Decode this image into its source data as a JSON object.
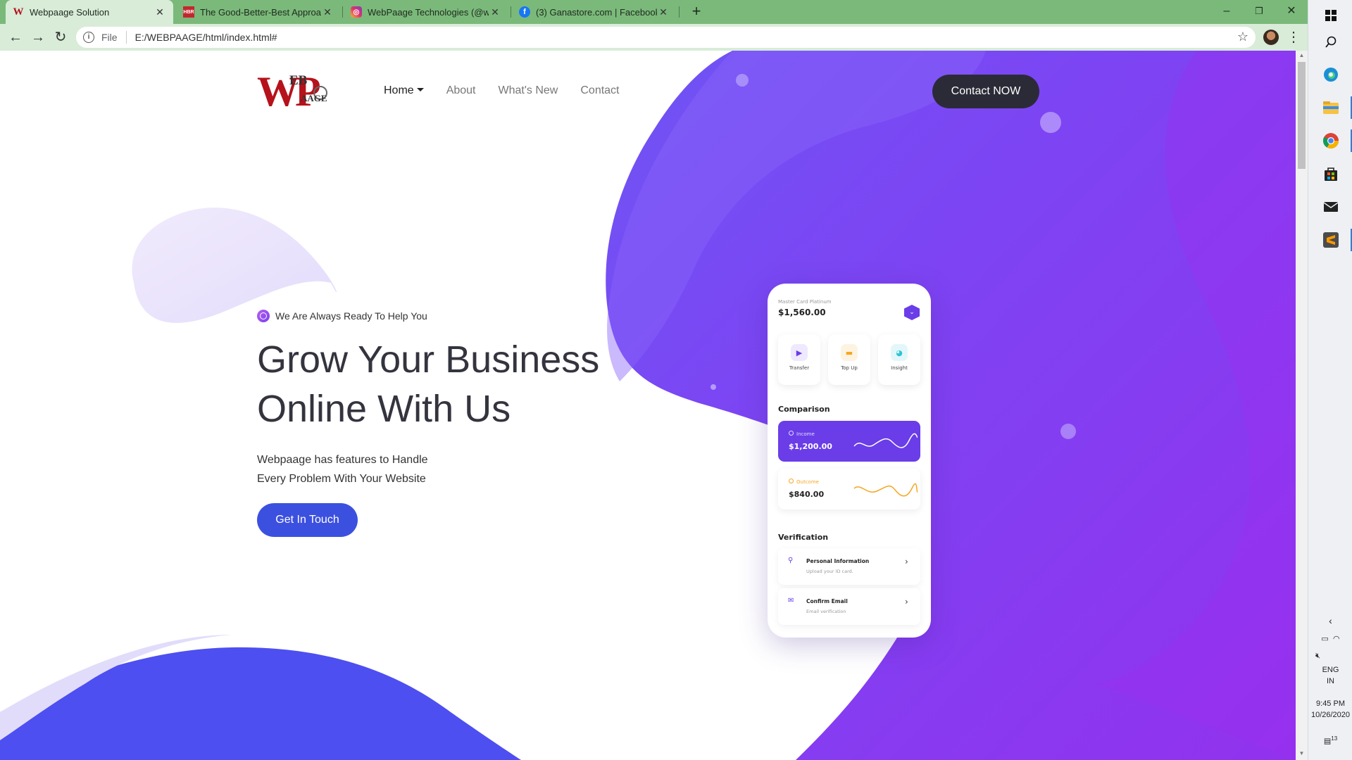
{
  "browser": {
    "tabs": [
      {
        "title": "Webpaage Solution",
        "icon": "webpaage-favicon-icon"
      },
      {
        "title": "The Good-Better-Best Approach",
        "icon": "hbr-favicon-icon"
      },
      {
        "title": "WebPaage Technologies (@webp",
        "icon": "instagram-favicon-icon"
      },
      {
        "title": "(3) Ganastore.com | Facebook",
        "icon": "facebook-favicon-icon"
      }
    ],
    "url_scheme": "File",
    "url": "E:/WEBPAAGE/html/index.html#"
  },
  "site": {
    "logo": {
      "big": "WP",
      "top": "EB",
      "bottom": "AAGE"
    },
    "nav": [
      {
        "label": "Home"
      },
      {
        "label": "About"
      },
      {
        "label": "What's New"
      },
      {
        "label": "Contact"
      }
    ],
    "cta_label": "Contact NOW",
    "tagline": "We Are Always Ready To Help You",
    "hero_line1": "Grow Your Business",
    "hero_line2": "Online With Us",
    "desc_line1": "Webpaage has features to Handle",
    "desc_line2": "Every Problem With Your Website",
    "button_label": "Get In Touch"
  },
  "phone": {
    "card_label": "Master Card Platinum",
    "card_amount": "$1,560.00",
    "actions": [
      {
        "label": "Transfer",
        "icon": "play-icon",
        "color": "#6a3de8"
      },
      {
        "label": "Top Up",
        "icon": "topup-icon",
        "color": "#f5a623"
      },
      {
        "label": "Insight",
        "icon": "pie-icon",
        "color": "#2ec4d6"
      }
    ],
    "comparison_title": "Comparison",
    "income_label": "Income",
    "income_value": "$1,200.00",
    "outcome_label": "Outcome",
    "outcome_value": "$840.00",
    "verification_title": "Verification",
    "verify_items": [
      {
        "title": "Personal Information",
        "subtitle": "Upload your ID card.",
        "icon": "person-icon"
      },
      {
        "title": "Confirm Email",
        "subtitle": "Email verification",
        "icon": "mail-icon"
      }
    ]
  },
  "taskbar": {
    "language": "ENG",
    "region": "IN",
    "time": "9:45 PM",
    "date": "10/26/2020",
    "notification_count": "13"
  },
  "colors": {
    "primary_purple": "#7b3ff0",
    "blob_blue": "#4f52ee",
    "button_blue": "#3c50e0",
    "cta_dark": "#2b2b38",
    "logo_red": "#b5121b"
  }
}
